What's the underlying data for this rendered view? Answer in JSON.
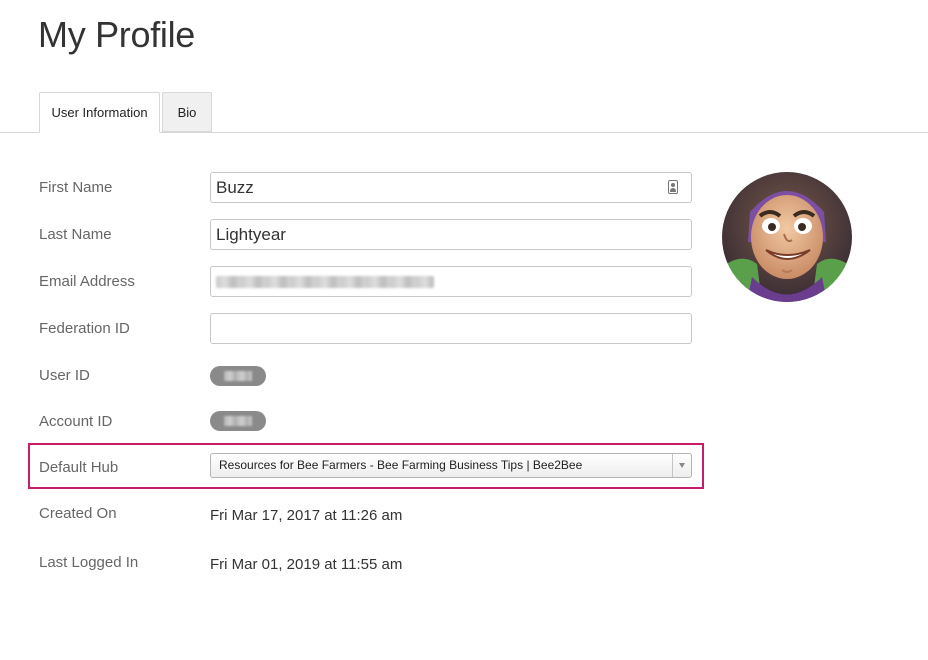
{
  "page": {
    "title": "My Profile"
  },
  "tabs": [
    {
      "label": "User Information",
      "active": true
    },
    {
      "label": "Bio",
      "active": false
    }
  ],
  "form": {
    "first_name": {
      "label": "First Name",
      "value": "Buzz"
    },
    "last_name": {
      "label": "Last Name",
      "value": "Lightyear"
    },
    "email": {
      "label": "Email Address",
      "value": ""
    },
    "federation_id": {
      "label": "Federation ID",
      "value": ""
    },
    "user_id": {
      "label": "User ID"
    },
    "account_id": {
      "label": "Account ID"
    },
    "default_hub": {
      "label": "Default Hub",
      "selected": "Resources for Bee Farmers - Bee Farming Business Tips | Bee2Bee"
    },
    "created_on": {
      "label": "Created On",
      "value": "Fri Mar 17, 2017 at 11:26 am"
    },
    "last_logged_in": {
      "label": "Last Logged In",
      "value": "Fri Mar 01, 2019 at 11:55 am"
    }
  },
  "colors": {
    "highlight": "#c81e6a",
    "text": "#333333",
    "label": "#666666"
  },
  "icons": {
    "first_name_field": "contact-card-icon",
    "default_hub_select": "chevron-down-icon"
  }
}
